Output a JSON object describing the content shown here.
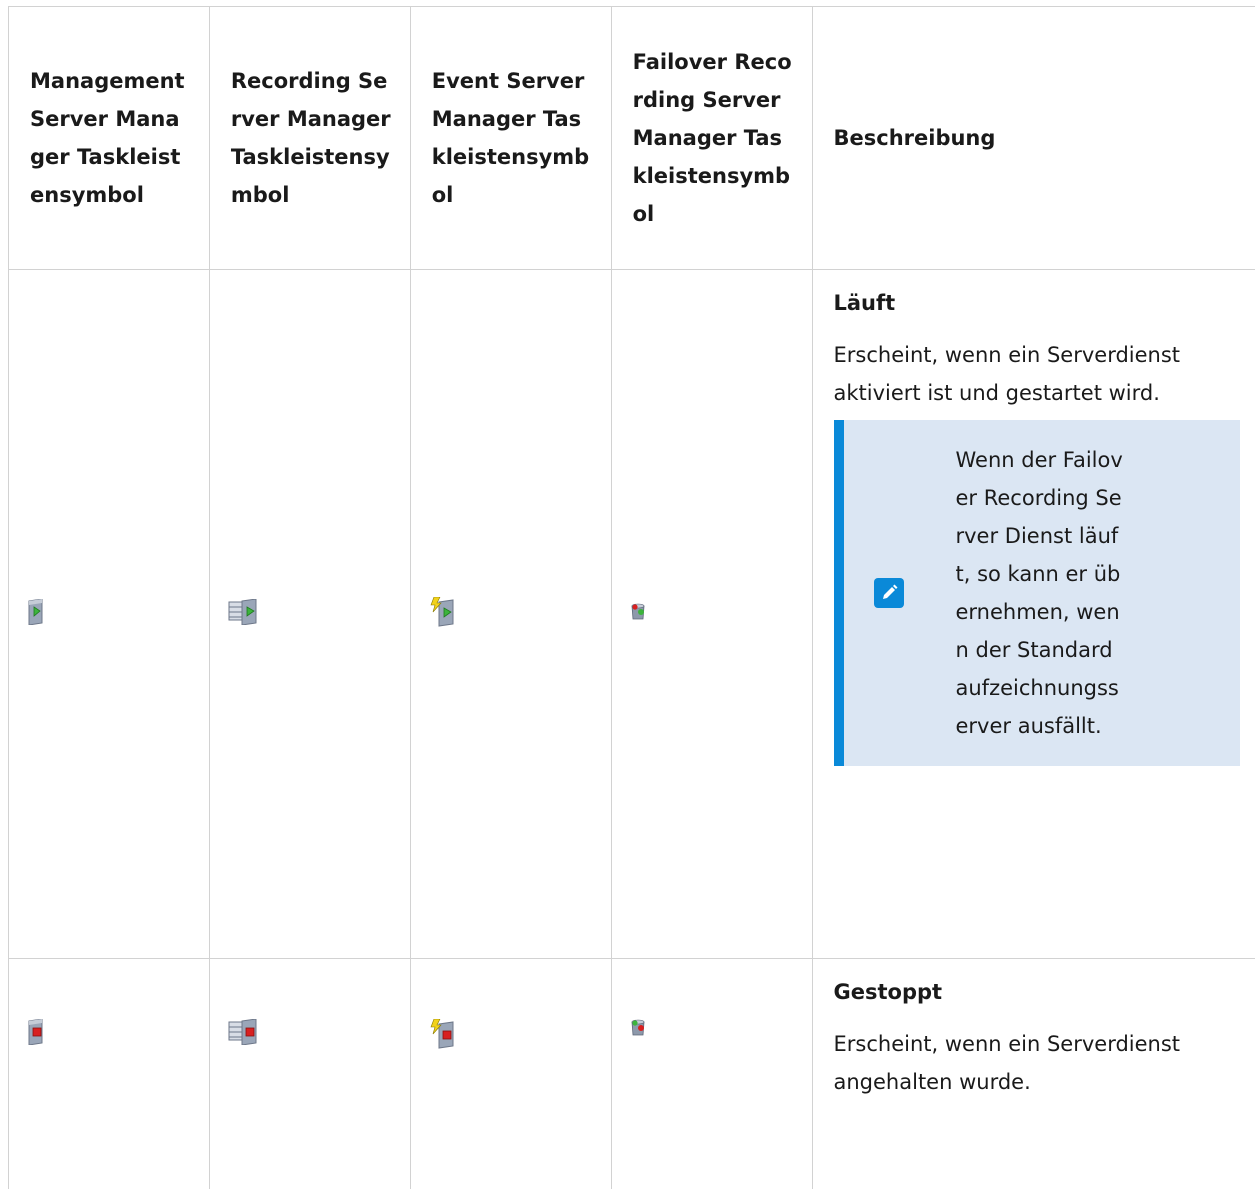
{
  "columns": [
    "Management Server Manager Taskleistensymbol",
    "Recording Server Manager Taskleistensymbol",
    "Event Server Manager Taskleistensymbol",
    "Failover Recording Server Manager Taskleistensymbol",
    "Beschreibung"
  ],
  "rows": [
    {
      "status": "Läuft",
      "description": "Erscheint, wenn ein Serverdienst aktiviert ist und gestartet wird.",
      "note": "Wenn der Failover Recording Server Dienst läuft, so kann er übernehmen, wenn der Standardaufzeichnungsserver ausfällt.",
      "icons": [
        "management-server-running-icon",
        "recording-server-running-icon",
        "event-server-running-icon",
        "failover-server-running-icon"
      ]
    },
    {
      "status": "Gestoppt",
      "description": "Erscheint, wenn ein Serverdienst angehalten wurde.",
      "icons": [
        "management-server-stopped-icon",
        "recording-server-stopped-icon",
        "event-server-stopped-icon",
        "failover-server-stopped-icon"
      ]
    }
  ],
  "colors": {
    "note_bg": "#dbe6f3",
    "note_accent": "#0a89d8",
    "running": "#3cb43c",
    "stopped": "#d82020",
    "border": "#d2d2d2"
  }
}
